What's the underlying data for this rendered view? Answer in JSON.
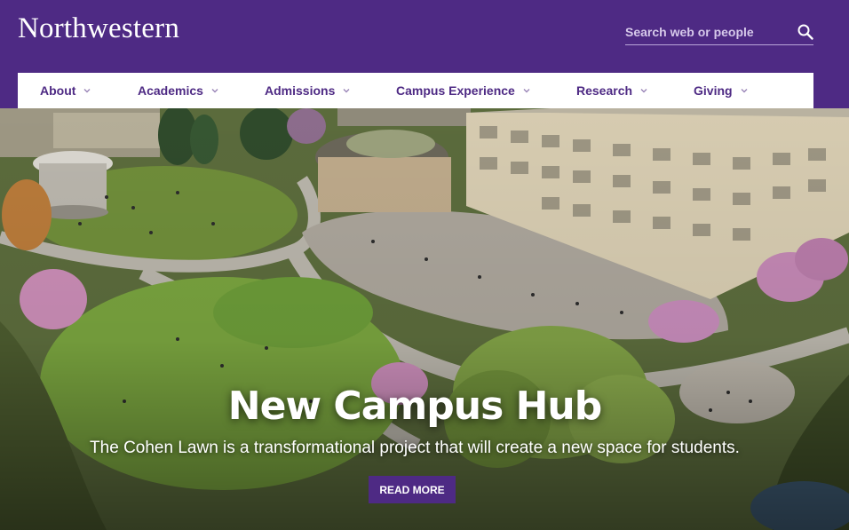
{
  "site": {
    "logo_text": "Northwestern"
  },
  "search": {
    "placeholder": "Search web or people",
    "icon": "search-icon"
  },
  "nav": {
    "items": [
      {
        "label": "About"
      },
      {
        "label": "Academics"
      },
      {
        "label": "Admissions"
      },
      {
        "label": "Campus Experience"
      },
      {
        "label": "Research"
      },
      {
        "label": "Giving"
      }
    ]
  },
  "hero": {
    "title": "New Campus Hub",
    "subtitle": "The Cohen Lawn is a transformational project that will create a new space for students.",
    "cta_label": "READ MORE"
  },
  "colors": {
    "brand_purple": "#4e2a84",
    "nav_bg": "#ffffff",
    "text_light": "#ffffff"
  }
}
